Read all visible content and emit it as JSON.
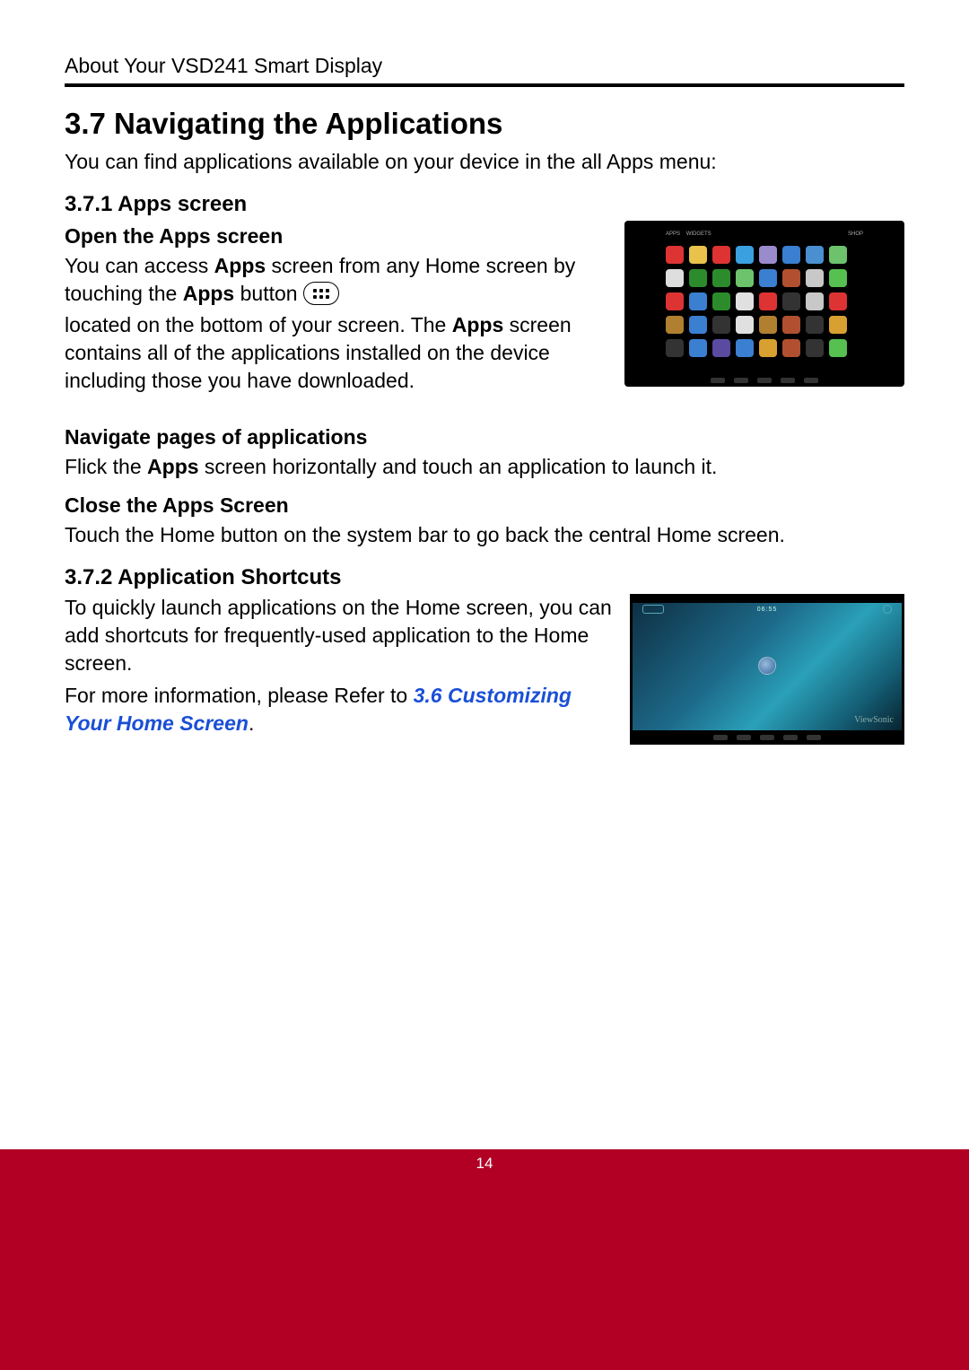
{
  "header": {
    "running_head": "About Your VSD241 Smart Display"
  },
  "section": {
    "number_title": "3.7  Navigating the Applications",
    "intro": "You can find applications available on your device in the all Apps menu:"
  },
  "sub1": {
    "heading": "3.7.1  Apps screen",
    "open_heading": "Open the Apps screen",
    "open_p1a": "You can access ",
    "open_p1b": "Apps",
    "open_p1c": " screen from any Home screen by touching the ",
    "open_p1d": "Apps",
    "open_p1e": " button ",
    "open_p2a": "located on the bottom of your screen. The ",
    "open_p2b": "Apps",
    "open_p2c": " screen contains all of the applications installed on the device including those you have downloaded.",
    "nav_heading": "Navigate pages of applications",
    "nav_p_a": "Flick the ",
    "nav_p_b": "Apps",
    "nav_p_c": " screen horizontally and touch an application to launch it.",
    "close_heading": "Close the Apps Screen",
    "close_p": "Touch the Home button on the system bar to go back the central Home screen."
  },
  "sub2": {
    "heading": "3.7.2  Application Shortcuts",
    "p1": "To quickly launch applications on the Home screen, you can add shortcuts for frequently-used application to the Home screen.",
    "p2a": "For more information, please Refer to ",
    "p2_link": "3.6 Customizing Your Home Screen",
    "p2b": "."
  },
  "figures": {
    "apps_tab_left": "APPS",
    "apps_tab_right": "WIDGETS",
    "apps_shop": "SHOP",
    "home_brand": "ViewSonic",
    "home_time": "06:55"
  },
  "footer": {
    "page_number": "14"
  },
  "icon_colors": [
    "#d33",
    "#e8c24a",
    "#d33",
    "#3aa0e0",
    "#9a8bcc",
    "#3a7fd0",
    "#4a8fd0",
    "#6cc36c",
    "#dedede",
    "#2c8c2c",
    "#2c8c2c",
    "#6cc36c",
    "#3a7fd0",
    "#b05030",
    "#c8c8c8",
    "#56c050",
    "#d33",
    "#3a7fd0",
    "#2c8c2c",
    "#e0e0e0",
    "#d33",
    "#333",
    "#c8c8c8",
    "#d33",
    "#b08030",
    "#3a7fd0",
    "#333",
    "#e0e0e0",
    "#b08030",
    "#b05030",
    "#333",
    "#d8a030",
    "#333",
    "#3a7fd0",
    "#5a4aa0",
    "#3a7fd0",
    "#d8a030",
    "#b05030",
    "#333",
    "#56c050"
  ]
}
